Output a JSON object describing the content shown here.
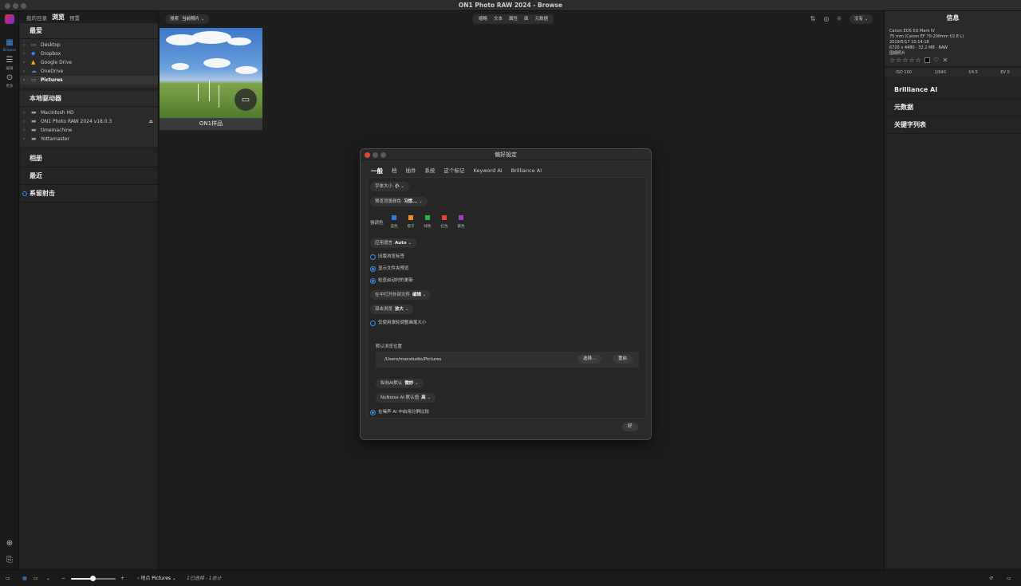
{
  "app": {
    "title": "ON1 Photo RAW 2024 - Browse"
  },
  "modules": [
    {
      "label": "Browse",
      "icon": "grid-icon"
    },
    {
      "label": "编辑",
      "icon": "sliders-icon"
    },
    {
      "label": "更多",
      "icon": "more-icon"
    }
  ],
  "left_panel": {
    "tabs": [
      "我的目录",
      "浏览",
      "预置"
    ],
    "active_tab": "浏览",
    "favorites": {
      "title": "最爱",
      "items": [
        "Desktop",
        "Dropbox",
        "Google Drive",
        "OneDrive",
        "Pictures"
      ],
      "selected": "Pictures"
    },
    "local_drives": {
      "title": "本地驱动器",
      "items": [
        "Macintosh HD",
        "ON1 Photo RAW 2024 v18.0.3",
        "timemachine",
        "Yottamaster"
      ]
    },
    "albums": "相册",
    "recent": "最近",
    "tethered": "系留射击"
  },
  "topbar": {
    "search_label": "搜索",
    "search_scope": "当前照片",
    "view_segments": [
      "缩略",
      "文本",
      "属性",
      "面",
      "元数据"
    ],
    "sort_value": "没有"
  },
  "canvas": {
    "thumbnail_caption": "ON1样品"
  },
  "right_panel": {
    "title": "信息",
    "camera": "Canon EOS 5D Mark IV",
    "lens": "75 mm (Canon EF 70-200mm f/2.8 L)",
    "datetime": "2019/5/17  10:14:18",
    "dimensions": "6720 x 4480  ·  32.2 MB  ·  RAW",
    "filename": "国姆照片",
    "iso": "ISO 100",
    "shutter": "1/640",
    "aperture": "f/4.5",
    "ev": "EV 0",
    "sections": [
      "Brilliance AI",
      "元数据",
      "关键字列表"
    ]
  },
  "bottombar": {
    "location_label": "地点",
    "location_value": "Pictures",
    "selection_text": "1已选择 - 1总计"
  },
  "dialog": {
    "title": "偏好設定",
    "tabs": [
      "一般",
      "档",
      "插件",
      "系统",
      "这个标记",
      "Keyword AI",
      "Brilliance AI"
    ],
    "active_tab": "一般",
    "font_size_label": "字体大小",
    "font_size_value": "小",
    "preview_bg_label": "预览背景颜色",
    "preview_bg_value": "习惯...",
    "accent_label": "强调色",
    "accent_colors": [
      {
        "name": "蓝色",
        "color": "#2a7be4"
      },
      {
        "name": "橙子",
        "color": "#f08a24"
      },
      {
        "name": "绿色",
        "color": "#2bb34a"
      },
      {
        "name": "红色",
        "color": "#e0443e"
      },
      {
        "name": "紫色",
        "color": "#a03ad0"
      }
    ],
    "app_language_label": "应用语言",
    "app_language_value": "Auto",
    "opt_old_browse_tab": "旧版浏览标签",
    "opt_show_folder_preview": "显示文件夹预览",
    "opt_check_updates": "检查启动时的更新",
    "open_external_label": "在中打开外部文件",
    "open_external_value": "编辑",
    "double_click_label": "双击浏览",
    "double_click_value": "放大",
    "opt_scroll_zoom": "仅使用滚轮调整画笔大小",
    "default_location_label": "默认浏览位置",
    "default_location_path": "/Users/macstudio/Pictures",
    "choose_button": "选择...",
    "reset_button": "重启",
    "ai_default_label": "纵向AI默认",
    "ai_default_value": "微妙",
    "nonoise_label": "NoNoise AI 默认值",
    "nonoise_value": "高",
    "opt_split_compare": "在噪声 AI 中启用分屏比较",
    "ok_button": "好"
  }
}
